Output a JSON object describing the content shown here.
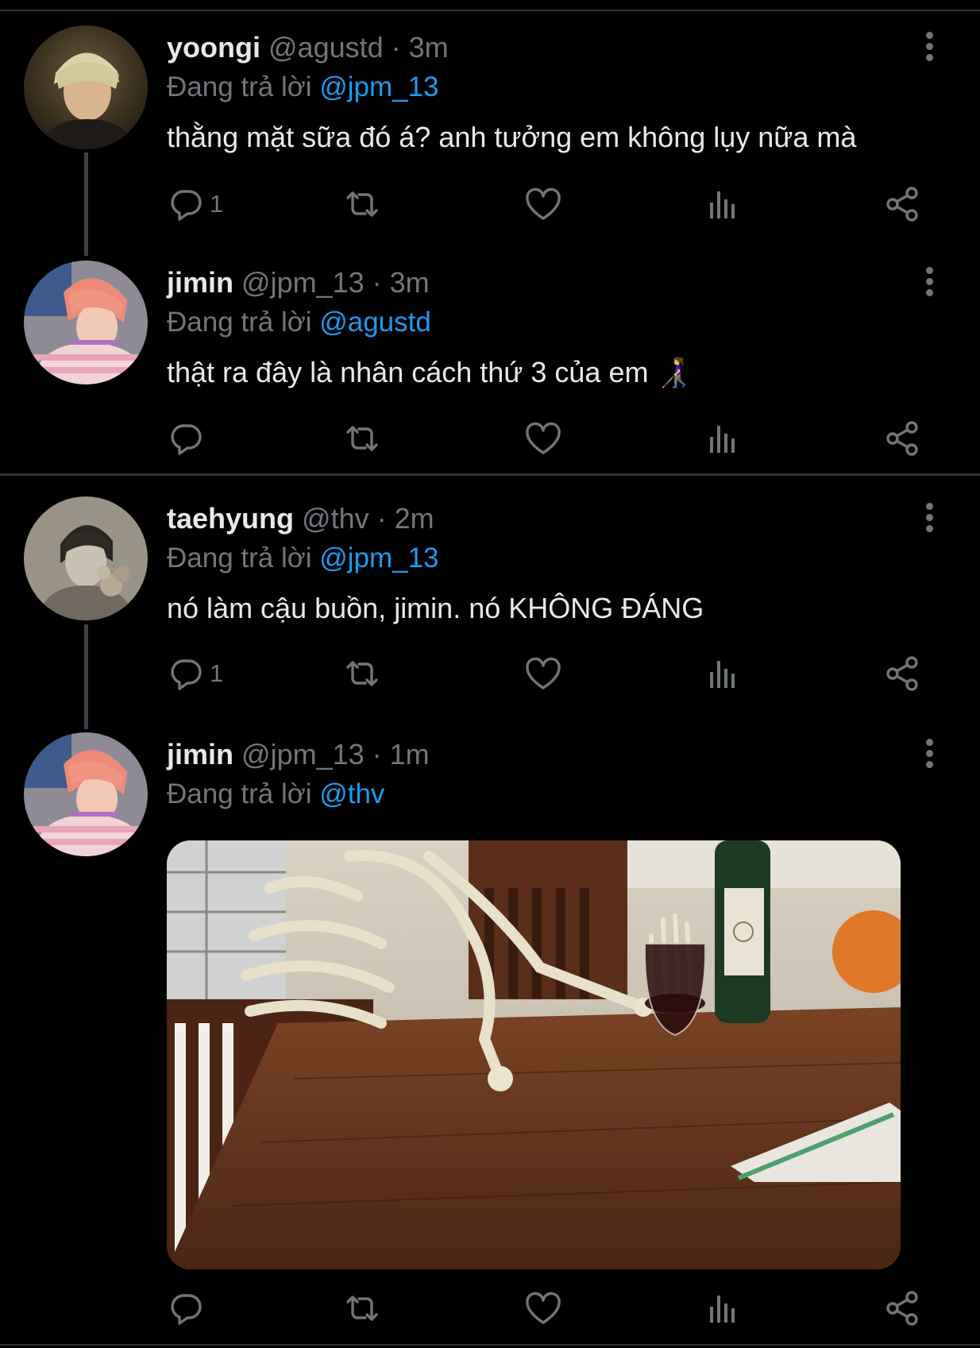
{
  "tweets": [
    {
      "name": "yoongi",
      "handle": "@agustd",
      "time": "· 3m",
      "reply_prefix": "Đang trả lời",
      "reply_to": "@jpm_13",
      "text": "thằng mặt sữa đó á? anh tưởng em không lụy nữa mà",
      "reply_count": "1"
    },
    {
      "name": "jimin",
      "handle": "@jpm_13",
      "time": "· 3m",
      "reply_prefix": "Đang trả lời",
      "reply_to": "@agustd",
      "text": "thật ra đây là nhân cách thứ 3 của em 👩‍🦯",
      "reply_count": ""
    },
    {
      "name": "taehyung",
      "handle": "@thv",
      "time": "· 2m",
      "reply_prefix": "Đang trả lời",
      "reply_to": "@jpm_13",
      "text": "nó làm cậu buồn, jimin. nó KHÔNG ĐÁNG",
      "reply_count": "1"
    },
    {
      "name": "jimin",
      "handle": "@jpm_13",
      "time": "· 1m",
      "reply_prefix": "Đang trả lời",
      "reply_to": "@thv",
      "text": "",
      "reply_count": ""
    }
  ],
  "icons": {
    "reply": "reply-icon",
    "retweet": "retweet-icon",
    "like": "heart-icon",
    "views": "views-icon",
    "share": "share-icon",
    "more": "more-icon"
  },
  "colors": {
    "background": "#000000",
    "text": "#e7e9ea",
    "muted": "#71767b",
    "mention": "#1d9bf0"
  }
}
